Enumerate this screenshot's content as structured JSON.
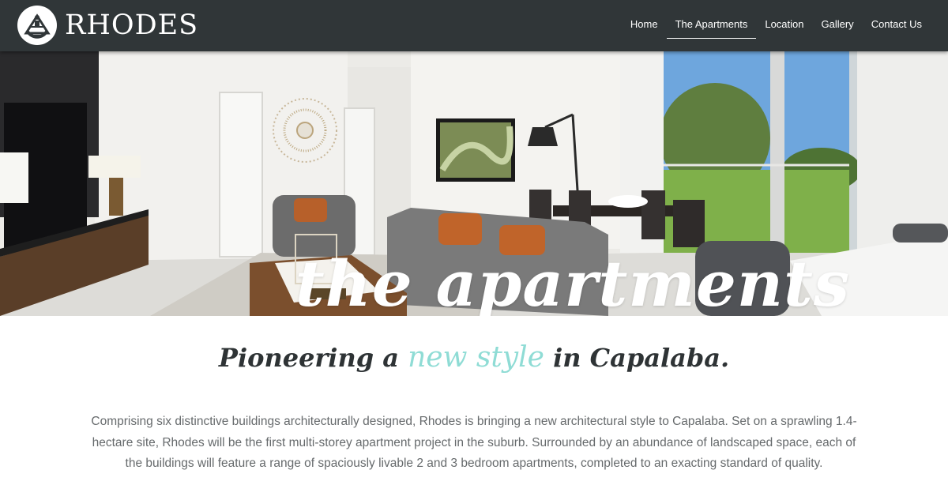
{
  "header": {
    "logo_text": "RHODES",
    "logo_icon": "sextant-emblem-icon"
  },
  "nav": {
    "items": [
      {
        "label": "Home",
        "active": false
      },
      {
        "label": "The Apartments",
        "active": true
      },
      {
        "label": "Location",
        "active": false
      },
      {
        "label": "Gallery",
        "active": false
      },
      {
        "label": "Contact Us",
        "active": false
      }
    ]
  },
  "hero": {
    "title": "the apartments"
  },
  "content": {
    "headline_before": "Pioneering a",
    "headline_accent": "new style",
    "headline_after": "in Capalaba.",
    "paragraph": "Comprising six distinctive buildings architecturally designed, Rhodes is bringing a new architectural style to Capalaba. Set on a sprawling 1.4-hectare site, Rhodes will be the first multi-storey apartment project in the suburb. Surrounded by an abundance of landscaped space, each of the buildings will feature a range of spaciously livable 2 and 3 bedroom apartments, completed to an exacting standard of quality."
  },
  "colors": {
    "nav_bg": "#303638",
    "accent": "#8fdcd5",
    "headline": "#2e3335",
    "body_text": "#666a6c"
  }
}
